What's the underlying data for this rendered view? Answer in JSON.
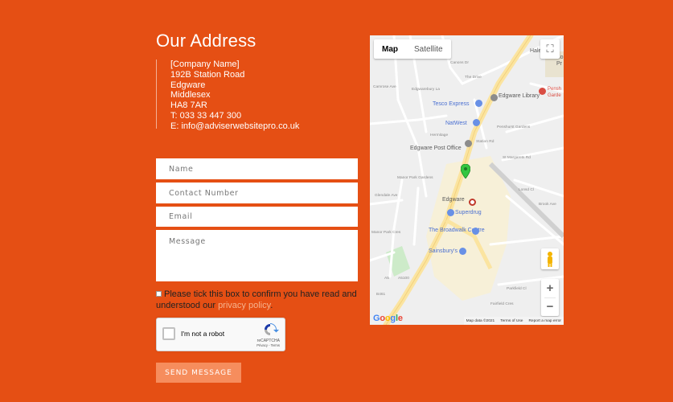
{
  "address": {
    "title": "Our Address",
    "lines": [
      "[Company Name]",
      "192B Station Road",
      "Edgware",
      "Middlesex",
      "HA8 7AR",
      "T: 033 33 447 300",
      "E: info@adviserwebsitepro.co.uk"
    ]
  },
  "form": {
    "name_placeholder": "Name",
    "contact_placeholder": "Contact Number",
    "email_placeholder": "Email",
    "message_placeholder": "Message",
    "consent_text": "Please tick this box to confirm you have read and understood our",
    "consent_link": "privacy policy",
    "consent_end": ".",
    "captcha_label": "I'm not a robot",
    "captcha_brand": "reCAPTCHA",
    "captcha_terms": "Privacy - Terms",
    "send_label": "SEND MESSAGE"
  },
  "map": {
    "tab_map": "Map",
    "tab_satellite": "Satellite",
    "fullscreen_icon": "⛶",
    "zoom_in": "+",
    "zoom_out": "−",
    "google": "Google",
    "attribution": [
      "Map data ©2021",
      "Terms of Use",
      "Report a map error"
    ],
    "places": {
      "tesco": "Tesco Express",
      "library": "Edgware Library",
      "natwest": "NatWest",
      "post_office": "Edgware Post Office",
      "edgware": "Edgware",
      "superdrug": "Superdrug",
      "broadwalk": "The Broadwalk Centre",
      "sainsburys": "Sainsbury's",
      "hale": "Hale",
      "bo": "Bo",
      "pr": "Pr",
      "pensh": "Pensh",
      "garde": "Garde"
    },
    "streets": [
      "The Drive",
      "Penshurst Gardens",
      "Hermitage",
      "St Margarets Rd",
      "Manor Park Gardens",
      "Manor Park Cres",
      "Parkfield Cl",
      "A5100",
      "A5",
      "B461",
      "Lonsd Cl",
      "Station Rd",
      "Edgwarebury La",
      "Glendale Ave",
      "Canons Dr",
      "Brook Ave",
      "Fairfield Cres",
      "Camrose Ave"
    ],
    "colors": {
      "land": "#efefef",
      "main_road": "#fbe4a0",
      "road": "#ffffff",
      "park": "#cdebc9",
      "water": "#aadaff",
      "marker": "#34c640"
    }
  }
}
